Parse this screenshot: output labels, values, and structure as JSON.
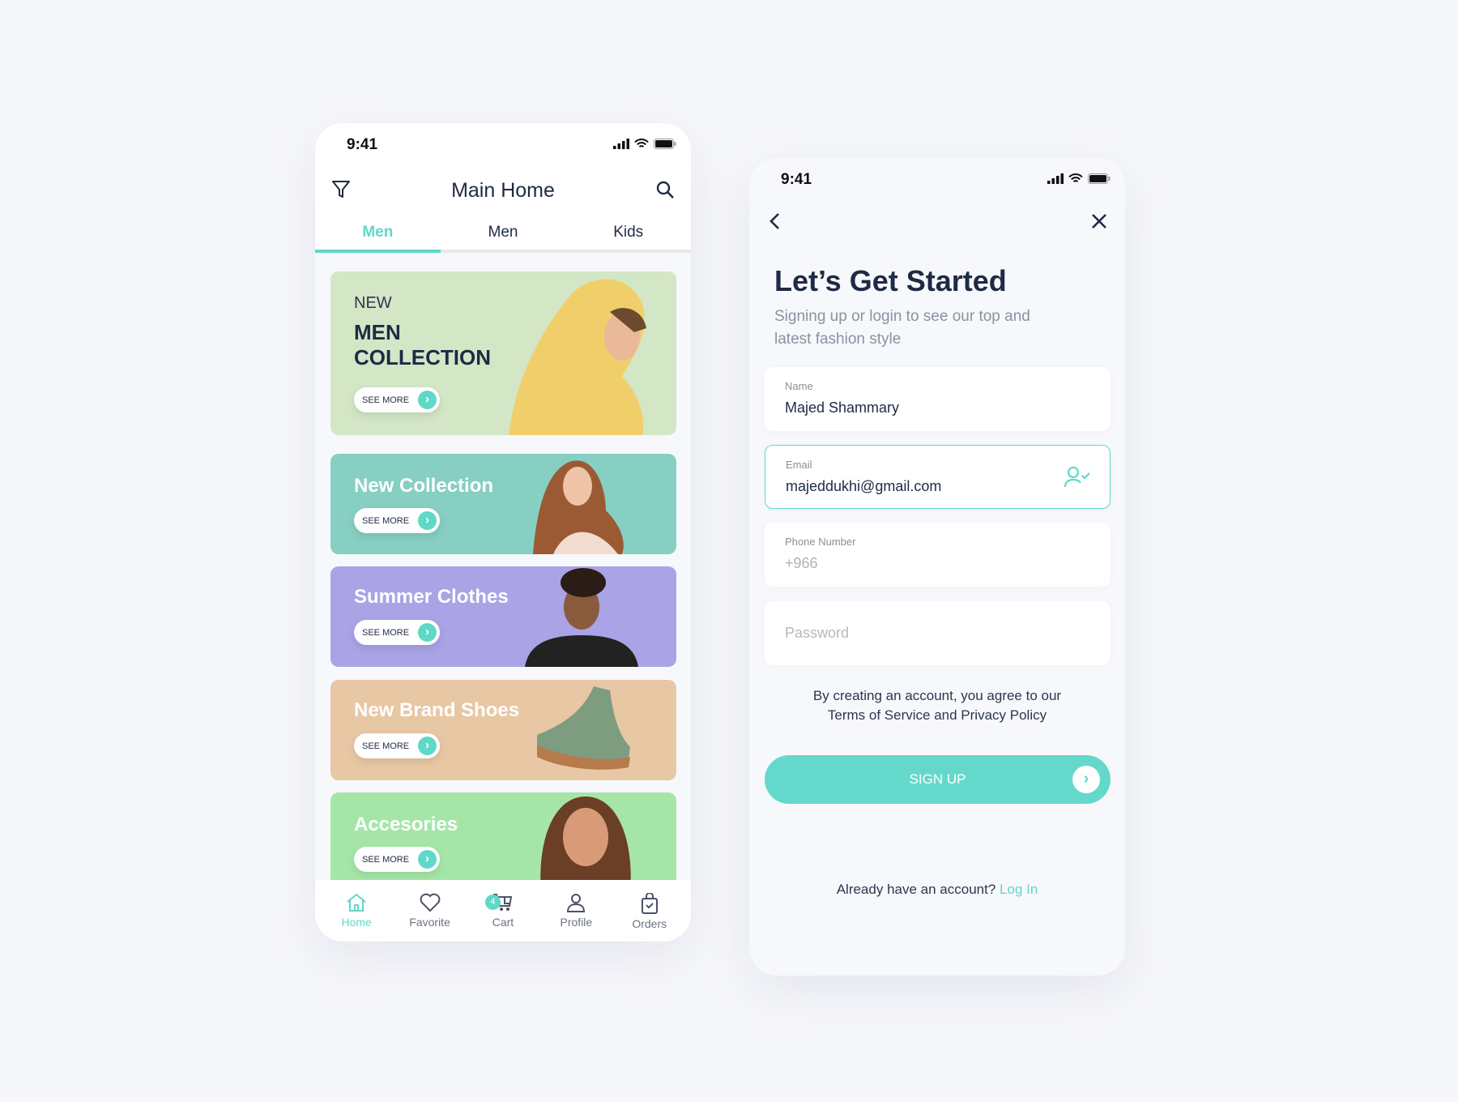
{
  "accent": "#5fd8c8",
  "home": {
    "status_time": "9:41",
    "title": "Main Home",
    "tabs": [
      "Men",
      "Men",
      "Kids"
    ],
    "banners": [
      {
        "kicker": "NEW",
        "title_line1": "MEN",
        "title_line2": "COLLECTION",
        "cta": "SEE MORE",
        "color": "#d3e6c6"
      },
      {
        "title": "New Collection",
        "cta": "SEE MORE",
        "color": "#87cfc3"
      },
      {
        "title": "Summer Clothes",
        "cta": "SEE MORE",
        "color": "#aaa3e6"
      },
      {
        "title": "New Brand Shoes",
        "cta": "SEE MORE",
        "color": "#e8c7a4"
      },
      {
        "title": "Accesories",
        "cta": "SEE MORE",
        "color": "#a5e6a8"
      }
    ],
    "nav": [
      {
        "label": "Home",
        "icon": "home-icon"
      },
      {
        "label": "Favorite",
        "icon": "heart-icon"
      },
      {
        "label": "Cart",
        "icon": "cart-icon",
        "badge": "4"
      },
      {
        "label": "Profile",
        "icon": "user-icon"
      },
      {
        "label": "Orders",
        "icon": "bag-icon"
      }
    ]
  },
  "signup": {
    "status_time": "9:41",
    "title": "Let’s Get Started",
    "subtitle": "Signing up or login to see our top and latest fashion style",
    "name_label": "Name",
    "name_value": "Majed Shammary",
    "email_label": "Email",
    "email_value": "majeddukhi@gmail.com",
    "phone_label": "Phone Number",
    "phone_placeholder": "+966",
    "password_placeholder": "Password",
    "terms_line1": "By creating an account, you agree to our",
    "terms_line2": "Terms of Service and Privacy Policy",
    "button": "SIGN UP",
    "already": "Already have an account?",
    "login": "Log In"
  }
}
